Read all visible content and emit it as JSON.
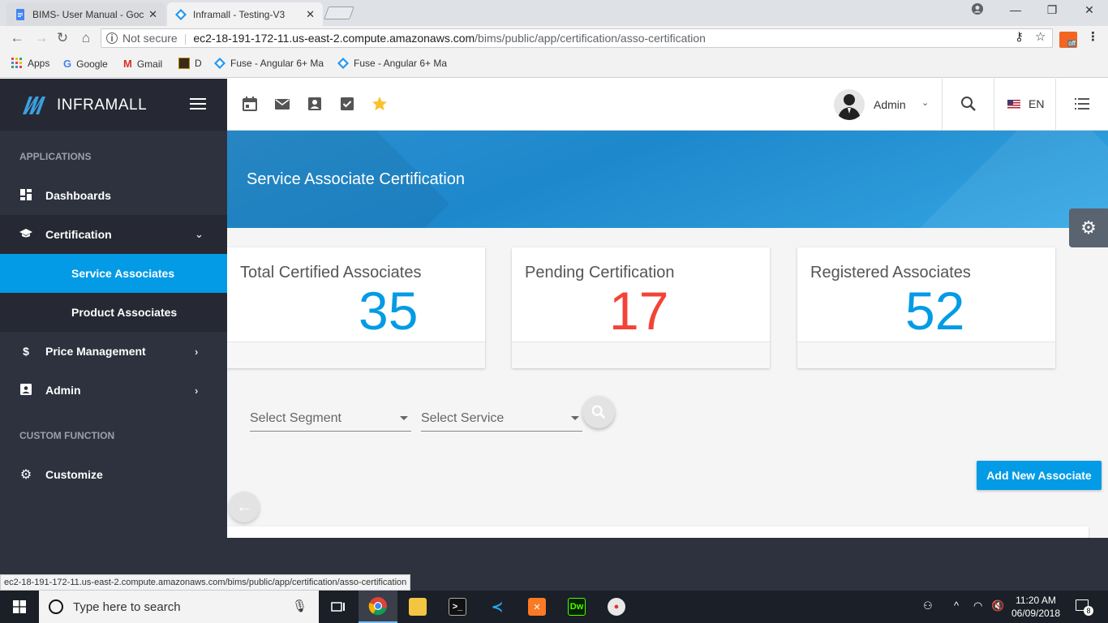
{
  "browser": {
    "tabs": [
      {
        "title": "BIMS- User Manual - Goc",
        "active": false
      },
      {
        "title": "Inframall - Testing-V3",
        "active": true
      }
    ],
    "omnibox": {
      "security": "Not secure",
      "host": "ec2-18-191-172-11.us-east-2.compute.amazonaws.com",
      "path": "/bims/public/app/certification/asso-certification"
    },
    "extension_badge": "off",
    "bookmarks": [
      {
        "label": "Apps",
        "icon": "apps-grid-icon"
      },
      {
        "label": "Google",
        "icon": "google-icon"
      },
      {
        "label": "Gmail",
        "icon": "gmail-icon"
      },
      {
        "label": "D",
        "icon": "bookmark-d-icon"
      },
      {
        "label": "Fuse - Angular 6+ Ma",
        "icon": "fuse-icon"
      },
      {
        "label": "Fuse - Angular 6+ Ma",
        "icon": "fuse-icon"
      }
    ],
    "status_url": "ec2-18-191-172-11.us-east-2.compute.amazonaws.com/bims/public/app/certification/asso-certification"
  },
  "sidebar": {
    "brand": "INFRAMALL",
    "sections": {
      "applications": "APPLICATIONS",
      "custom": "CUSTOM FUNCTION"
    },
    "items": {
      "dashboards": "Dashboards",
      "certification": "Certification",
      "service_associates": "Service Associates",
      "product_associates": "Product Associates",
      "price_management": "Price Management",
      "admin": "Admin",
      "customize": "Customize"
    }
  },
  "appbar": {
    "user_name": "Admin",
    "language": "EN"
  },
  "page": {
    "title": "Service Associate Certification",
    "stats": [
      {
        "label": "Total Certified Associates",
        "value": "35",
        "color": "#039be5"
      },
      {
        "label": "Pending Certification",
        "value": "17",
        "color": "#f44336"
      },
      {
        "label": "Registered Associates",
        "value": "52",
        "color": "#039be5"
      }
    ],
    "filters": {
      "segment_placeholder": "Select Segment",
      "service_placeholder": "Select Service"
    },
    "add_button": "Add New Associate"
  },
  "taskbar": {
    "search_placeholder": "Type here to search",
    "time": "11:20 AM",
    "date": "06/09/2018",
    "notifications": "8"
  },
  "colors": {
    "accent": "#039be5",
    "sidebar_bg": "#2d323e",
    "sidebar_header_bg": "#262933",
    "danger": "#f44336"
  }
}
